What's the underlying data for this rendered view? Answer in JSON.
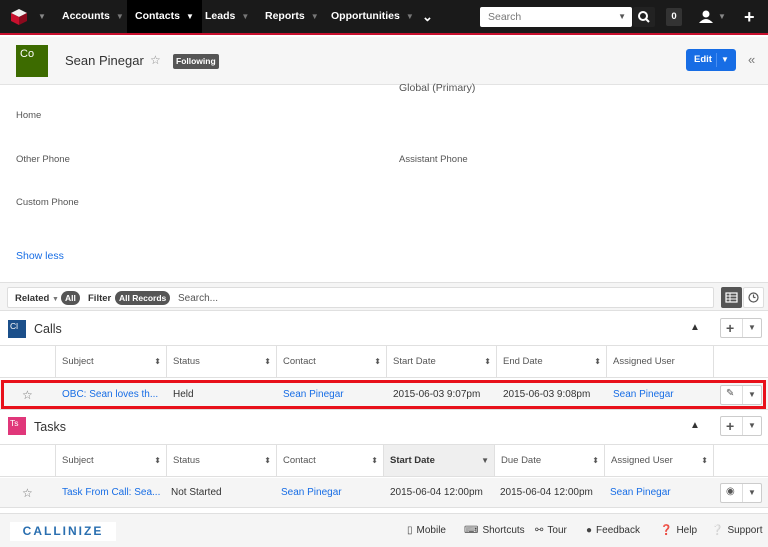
{
  "nav": {
    "items": [
      {
        "label": "Accounts"
      },
      {
        "label": "Contacts"
      },
      {
        "label": "Leads"
      },
      {
        "label": "Reports"
      },
      {
        "label": "Opportunities"
      }
    ],
    "search_placeholder": "Search",
    "notification_count": "0"
  },
  "record": {
    "initials": "Co",
    "name": "Sean Pinegar",
    "following_label": "Following",
    "edit_label": "Edit"
  },
  "fields": {
    "global_primary": "Global (Primary)",
    "home": "Home",
    "other_phone": "Other Phone",
    "assistant_phone": "Assistant Phone",
    "custom_phone": "Custom Phone",
    "show_less": "Show less"
  },
  "toolbar": {
    "related": "Related",
    "related_value": "All",
    "filter": "Filter",
    "filter_value": "All Records",
    "search_placeholder": "Search..."
  },
  "calls": {
    "badge": "Cl",
    "title": "Calls",
    "columns": [
      "Subject",
      "Status",
      "Contact",
      "Start Date",
      "End Date",
      "Assigned User"
    ],
    "rows": [
      {
        "subject": "OBC: Sean loves th...",
        "status": "Held",
        "contact": "Sean Pinegar",
        "start": "2015-06-03 9:07pm",
        "end": "2015-06-03 9:08pm",
        "user": "Sean Pinegar"
      }
    ]
  },
  "tasks": {
    "badge": "Ts",
    "title": "Tasks",
    "columns": [
      "Subject",
      "Status",
      "Contact",
      "Start Date",
      "Due Date",
      "Assigned User"
    ],
    "rows": [
      {
        "subject": "Task From Call: Sea...",
        "status": "Not Started",
        "contact": "Sean Pinegar",
        "start": "2015-06-04 12:00pm",
        "due": "2015-06-04 12:00pm",
        "user": "Sean Pinegar"
      }
    ]
  },
  "footer": {
    "brand": "CALLINIZE",
    "links": [
      "Mobile",
      "Shortcuts",
      "Tour",
      "Feedback",
      "Help",
      "Support"
    ]
  },
  "colors": {
    "accent_blue": "#176de5",
    "nav_bg": "#1a1a1a",
    "calls_badge": "#1b4f8a",
    "tasks_badge": "#e0377a",
    "avatar": "#3d6b00",
    "highlight": "#e8101a"
  }
}
